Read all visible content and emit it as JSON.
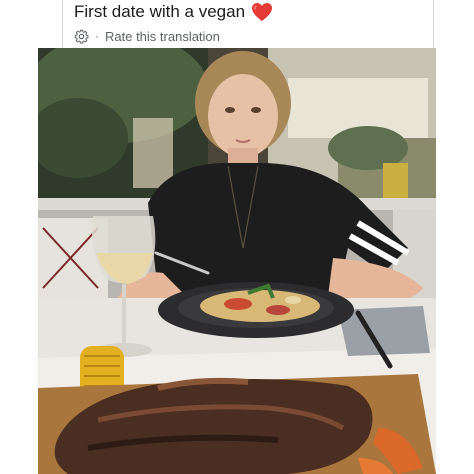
{
  "post": {
    "title": "First date with a vegan",
    "title_emoji": "heart",
    "rate_label": "Rate this translation",
    "separator": "·"
  },
  "icons": {
    "heart": "heart-icon",
    "settings": "gear-icon"
  },
  "colors": {
    "heart": "#e53935",
    "muted_text": "#5f6368",
    "title_text": "#1c1c1c"
  }
}
